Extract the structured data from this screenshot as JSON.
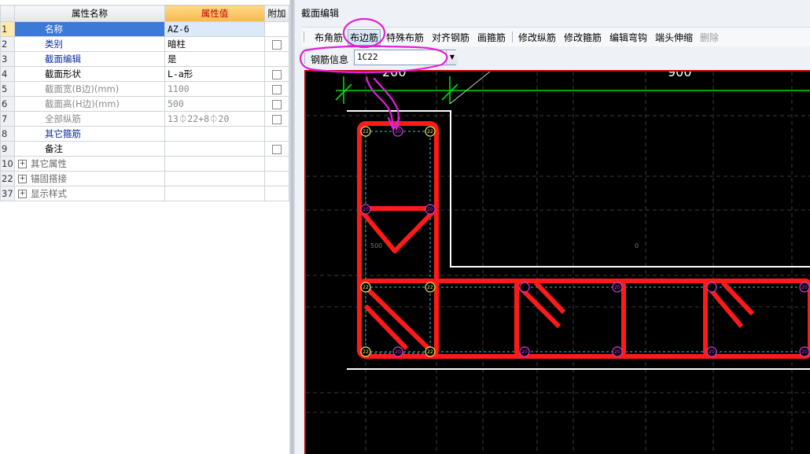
{
  "property_panel": {
    "header": {
      "name_col": "属性名称",
      "value_col": "属性值",
      "extra_col": "附加"
    },
    "rows": [
      {
        "num": "1",
        "name": "名称",
        "value": "AZ-6",
        "selected": true,
        "checkbox": false
      },
      {
        "num": "2",
        "name": "类别",
        "value": "暗柱",
        "checkbox": true
      },
      {
        "num": "3",
        "name": "截面编辑",
        "value": "是",
        "checkbox": false
      },
      {
        "num": "4",
        "name": "截面形状",
        "value": "L-a形",
        "checkbox": true
      },
      {
        "num": "5",
        "name": "截面宽(B边)(mm)",
        "value": "1100",
        "checkbox": true
      },
      {
        "num": "6",
        "name": "截面高(H边)(mm)",
        "value": "500",
        "checkbox": true
      },
      {
        "num": "7",
        "name": "全部纵筋",
        "value": "13⏀22+8⏀20",
        "checkbox": true
      },
      {
        "num": "8",
        "name": "其它箍筋",
        "value": "",
        "checkbox": false
      },
      {
        "num": "9",
        "name": "备注",
        "value": "",
        "checkbox": true
      },
      {
        "num": "10",
        "name": "其它属性",
        "group": true
      },
      {
        "num": "22",
        "name": "锚固搭接",
        "group": true
      },
      {
        "num": "37",
        "name": "显示样式",
        "group": true
      }
    ]
  },
  "section_editor": {
    "title": "截面编辑",
    "toolbar": {
      "corner": "布角筋",
      "edge": "布边筋",
      "special": "特殊布筋",
      "align": "对齐钢筋",
      "stirrup": "画箍筋",
      "modify_long": "修改纵筋",
      "modify_stirrup": "修改箍筋",
      "edit_hook": "编辑弯钩",
      "end_stretch": "端头伸缩",
      "delete": "删除"
    },
    "rebar_info_label": "钢筋信息",
    "rebar_info_value": "1C22"
  },
  "canvas": {
    "dim_top_left": "200",
    "dim_top_right": "900",
    "axis_label_left": "500",
    "axis_label_mid": "0",
    "bar_label_corner": "22",
    "bar_label_edge": "20"
  },
  "colors": {
    "stirrup": "#ff1a1a",
    "outline": "#ffffff",
    "dimension": "#00dd00",
    "annotation": "#e020d8",
    "corner_bar": "#f0f060",
    "edge_bar": "#d040e0"
  }
}
